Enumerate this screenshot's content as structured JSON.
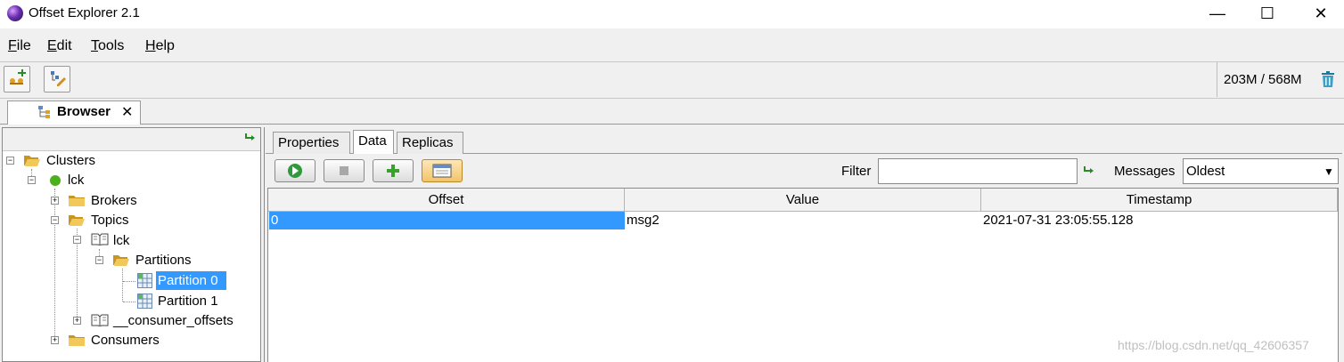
{
  "window": {
    "title": "Offset Explorer  2.1",
    "minimize_glyph": "—",
    "maximize_glyph": "☐",
    "close_glyph": "✕"
  },
  "menu": {
    "file_u": "F",
    "file_rest": "ile",
    "edit_u": "E",
    "edit_rest": "dit",
    "tools_u": "T",
    "tools_rest": "ools",
    "help_u": "H",
    "help_rest": "elp"
  },
  "toolbar": {
    "memory": "203M / 568M"
  },
  "browser_tab": {
    "label": "Browser",
    "close": "✕"
  },
  "tree": {
    "clusters": "Clusters",
    "cluster_name": "lck",
    "brokers": "Brokers",
    "topics": "Topics",
    "topic_name": "lck",
    "partitions": "Partitions",
    "partition0": "Partition 0",
    "partition1": "Partition 1",
    "consumer_offsets": "__consumer_offsets",
    "consumers": "Consumers"
  },
  "detail_tabs": {
    "properties": "Properties",
    "data": "Data",
    "replicas": "Replicas"
  },
  "filter": {
    "label": "Filter",
    "value": ""
  },
  "messages": {
    "label": "Messages",
    "selected": "Oldest"
  },
  "table": {
    "columns": [
      "Offset",
      "Value",
      "Timestamp"
    ],
    "rows": [
      {
        "offset": "0",
        "value": "msg2",
        "timestamp": "2021-07-31 23:05:55.128"
      }
    ]
  },
  "watermark": "https://blog.csdn.net/qq_42606357",
  "colors": {
    "selection": "#3399ff",
    "status_green": "#4caf1e"
  }
}
